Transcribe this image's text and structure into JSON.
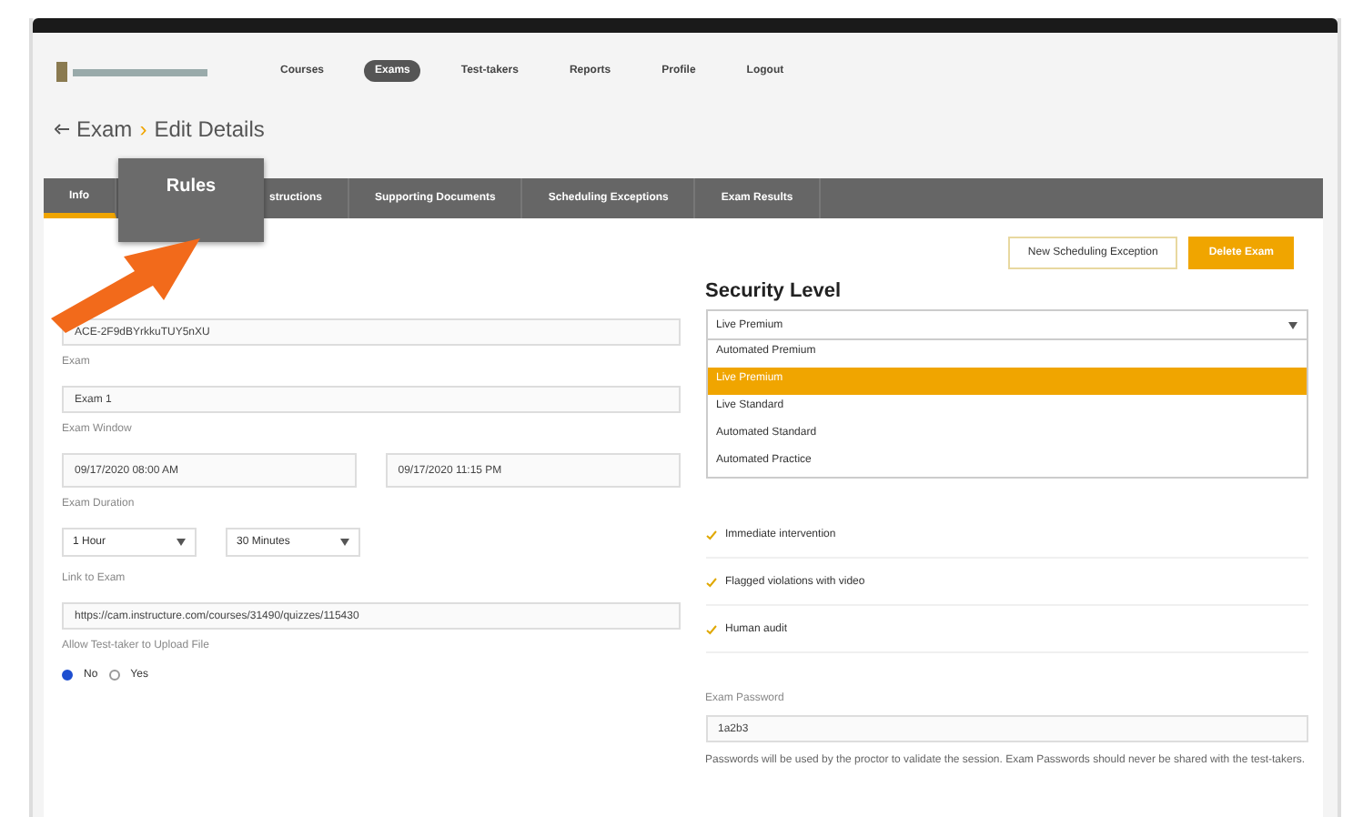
{
  "nav": {
    "items": [
      {
        "label": "Courses",
        "selected": false
      },
      {
        "label": "Exams",
        "selected": true
      },
      {
        "label": "Test-takers",
        "selected": false
      },
      {
        "label": "Reports",
        "selected": false
      },
      {
        "label": "Profile",
        "selected": false
      },
      {
        "label": "Logout",
        "selected": false
      }
    ]
  },
  "breadcrumb": {
    "parent": "Exam",
    "separator": "›",
    "current": "Edit Details"
  },
  "tabs": [
    {
      "label": "Info",
      "selected": true
    },
    {
      "label": "structions",
      "selected": false
    },
    {
      "label": "Supporting Documents",
      "selected": false
    },
    {
      "label": "Scheduling Exceptions",
      "selected": false
    },
    {
      "label": "Exam Results",
      "selected": false
    }
  ],
  "callout": {
    "label": "Rules"
  },
  "left_form": {
    "fields": [
      {
        "kind": "text",
        "value": "ACE-2F9dBYrkkuTUY5nXU"
      },
      {
        "kind": "label",
        "text": "Exam"
      },
      {
        "kind": "text",
        "value": "Exam 1"
      },
      {
        "kind": "label",
        "text": "Exam Window"
      },
      {
        "kind": "pair",
        "values": [
          "09/17/2020 08:00 AM",
          "09/17/2020 11:15 PM"
        ]
      },
      {
        "kind": "label",
        "text": "Exam Duration"
      },
      {
        "kind": "selects",
        "values": [
          "1 Hour",
          "30 Minutes"
        ]
      },
      {
        "kind": "label",
        "text": "Link to Exam"
      },
      {
        "kind": "text",
        "value": "https://cam.instructure.com/courses/31490/quizzes/115430"
      },
      {
        "kind": "label",
        "text": "Allow Test-taker to Upload File"
      }
    ],
    "radios": [
      {
        "label": "No",
        "selected": true
      },
      {
        "label": "Yes",
        "selected": false
      }
    ]
  },
  "buttons": [
    {
      "label": "New Scheduling Exception",
      "kind": "outline"
    },
    {
      "label": "Delete Exam",
      "kind": "primary"
    }
  ],
  "security": {
    "title": "Security Level",
    "value": "Live Premium",
    "options": [
      {
        "label": "Automated Premium",
        "selected": false
      },
      {
        "label": "Live Premium",
        "selected": true
      },
      {
        "label": "Live Standard",
        "selected": false
      },
      {
        "label": "Automated Standard",
        "selected": false
      },
      {
        "label": "Automated Practice",
        "selected": false
      }
    ],
    "features": [
      {
        "label": "Immediate intervention",
        "checked": true
      },
      {
        "label": "Flagged violations with video",
        "checked": true
      },
      {
        "label": "Human audit",
        "checked": true
      }
    ]
  },
  "password": {
    "label": "Exam Password",
    "value": "1a2b3",
    "help": "Passwords will be used by the proctor to validate the session. Exam Passwords should never be shared with the test-takers."
  }
}
